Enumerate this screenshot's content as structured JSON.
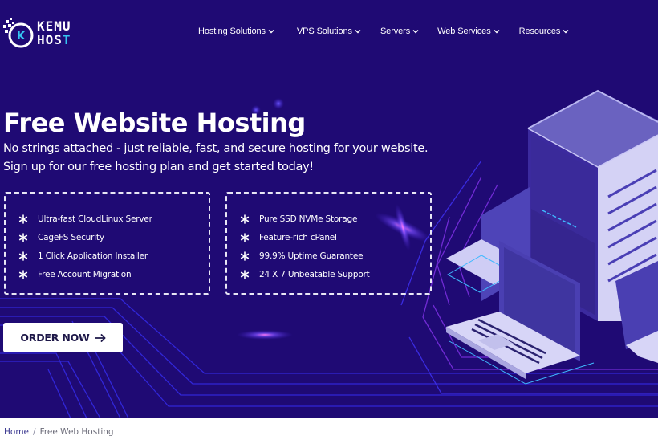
{
  "brand": {
    "name_line1": "KEMU",
    "name_line2_prefix": "HOS",
    "name_line2_accent": "T",
    "accent_color": "#35c4f2"
  },
  "nav": {
    "items": [
      {
        "label": "Hosting Solutions",
        "icon": "chevron-down-icon"
      },
      {
        "label": "VPS Solutions",
        "icon": "chevron-down-icon"
      },
      {
        "label": "Servers",
        "icon": "chevron-down-icon"
      },
      {
        "label": "Web Services",
        "icon": "chevron-down-icon"
      },
      {
        "label": "Resources",
        "icon": "chevron-down-icon"
      }
    ]
  },
  "hero": {
    "title": "Free Website Hosting",
    "subtitle_line1": "No strings attached - just reliable, fast, and secure hosting for your website.",
    "subtitle_line2": "Sign up for our free hosting plan and get started today!",
    "background_color": "#1f0a74",
    "features_left": [
      "Ultra-fast CloudLinux Server",
      "CageFS Security",
      "1 Click Application Installer",
      "Free Account Migration"
    ],
    "features_right": [
      "Pure SSD NVMe Storage",
      "Feature-rich cPanel",
      "99.9% Uptime Guarantee",
      "24 X 7 Unbeatable Support"
    ],
    "feature_icon": "snowflake-icon",
    "cta_label": "ORDER NOW",
    "cta_icon": "arrow-right-icon"
  },
  "breadcrumb": {
    "home": "Home",
    "separator": "/",
    "current": "Free Web Hosting"
  }
}
